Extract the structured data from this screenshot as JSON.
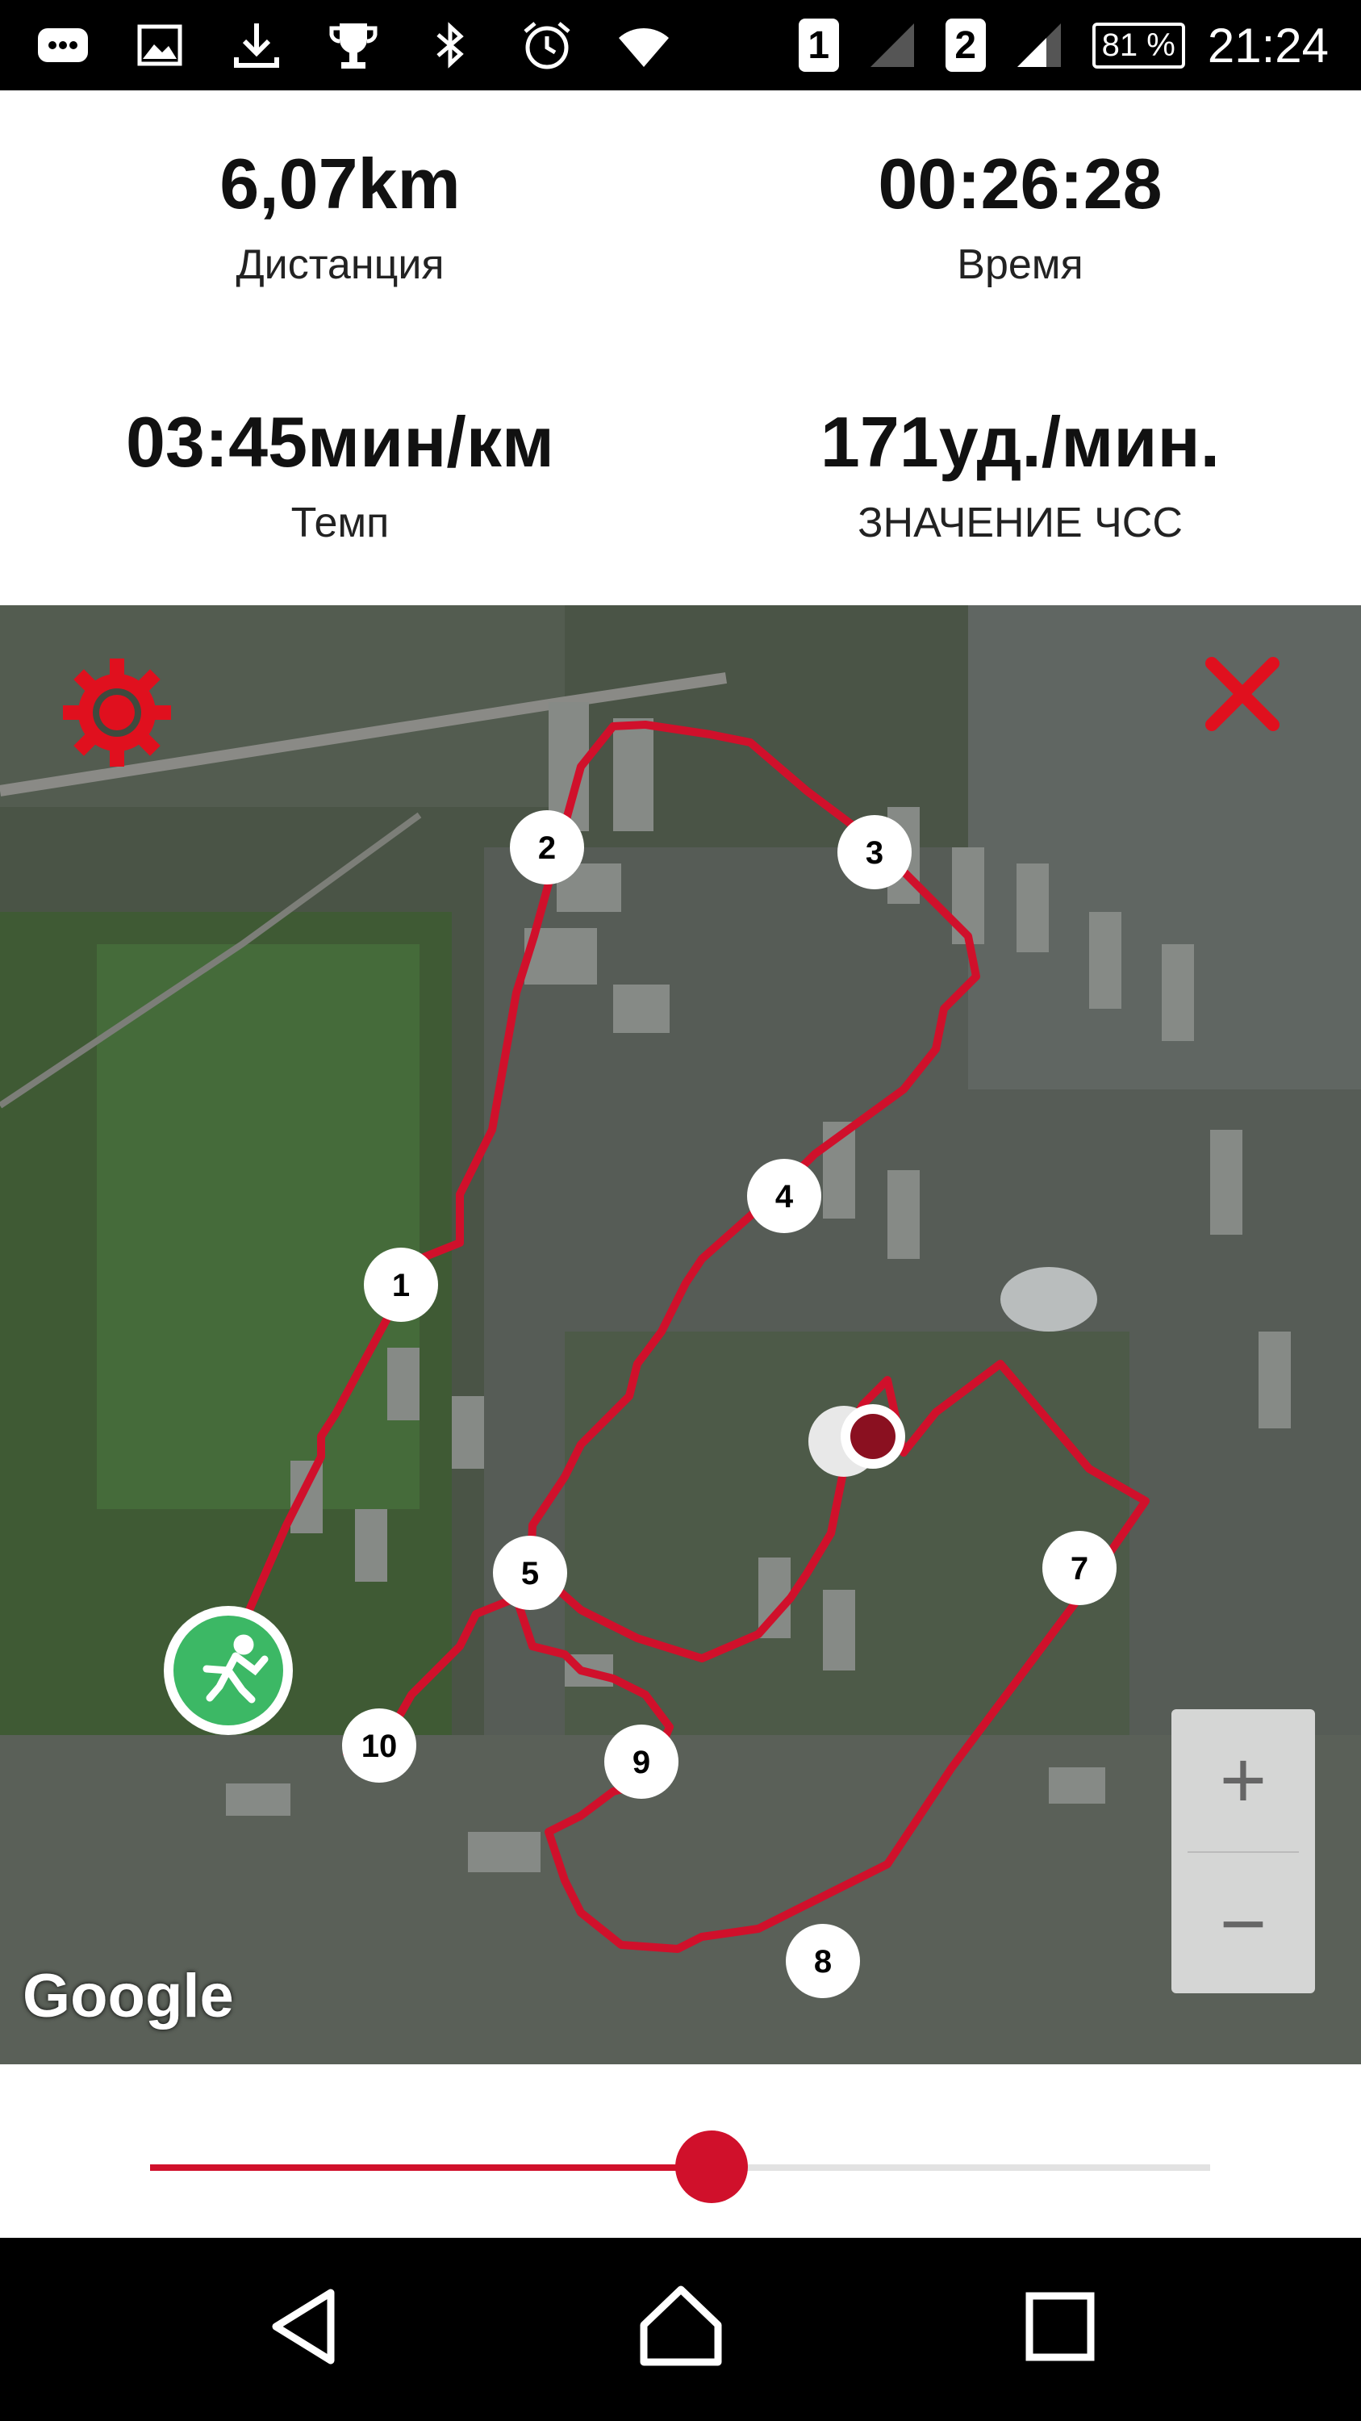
{
  "status_bar": {
    "sim1": "1",
    "sim2": "2",
    "battery": "81 %",
    "time": "21:24",
    "left_icons": [
      "messaging-icon",
      "image-icon",
      "download-icon",
      "trophy-icon",
      "bluetooth-icon",
      "alarm-icon",
      "wifi-icon"
    ]
  },
  "stats": {
    "distance": {
      "value": "6,07km",
      "label": "Дистанция"
    },
    "time": {
      "value": "00:26:28",
      "label": "Время"
    },
    "pace": {
      "value": "03:45мин/км",
      "label": "Темп"
    },
    "heart_rate": {
      "value": "171уд./мин.",
      "label": "ЗНАЧЕНИЕ ЧСС"
    }
  },
  "map": {
    "attribution": "Google",
    "route_color": "#d0102b",
    "markers": [
      "1",
      "2",
      "3",
      "4",
      "5",
      "7",
      "8",
      "9",
      "10"
    ],
    "zoom_in": "+",
    "zoom_out": "−"
  },
  "slider": {
    "progress": 0.53,
    "color": "#d0102b"
  },
  "nav_icons": [
    "back-icon",
    "home-icon",
    "recents-icon"
  ]
}
